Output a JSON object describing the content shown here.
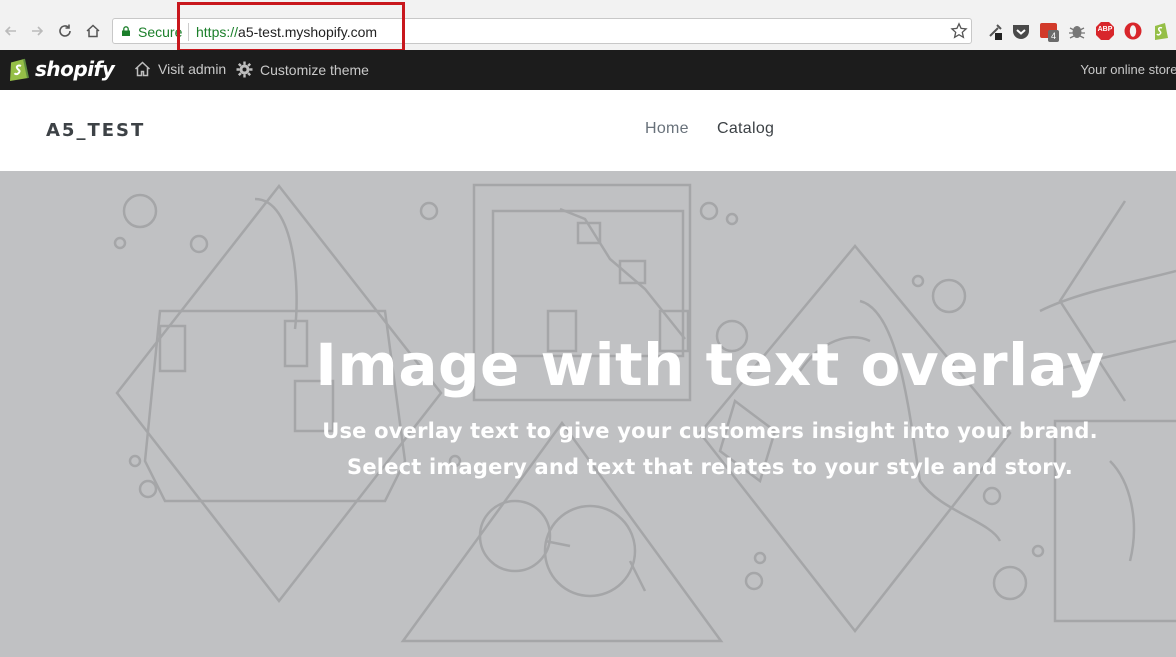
{
  "browser": {
    "secure_label": "Secure",
    "url_scheme": "https://",
    "url_host": "a5-test.myshopify.com",
    "extension_badge_count": "4",
    "extension_abp_label": "ABP"
  },
  "admin_bar": {
    "logo_text": "shopify",
    "visit_admin_label": "Visit admin",
    "customize_theme_label": "Customize theme",
    "status_text": "Your online store i"
  },
  "store": {
    "name": "A5_TEST",
    "nav": [
      {
        "label": "Home"
      },
      {
        "label": "Catalog"
      }
    ]
  },
  "hero": {
    "title": "Image with text overlay",
    "subtitle_line1": "Use overlay text to give your customers insight into your brand.",
    "subtitle_line2": "Select imagery and text that relates to your style and story."
  },
  "colors": {
    "accent_highlight": "#c8171d",
    "secure_green": "#1b7f2a",
    "admin_bar_bg": "#1c1c1c",
    "shopify_green": "#95bf47",
    "hero_bg": "#c0c1c3"
  }
}
